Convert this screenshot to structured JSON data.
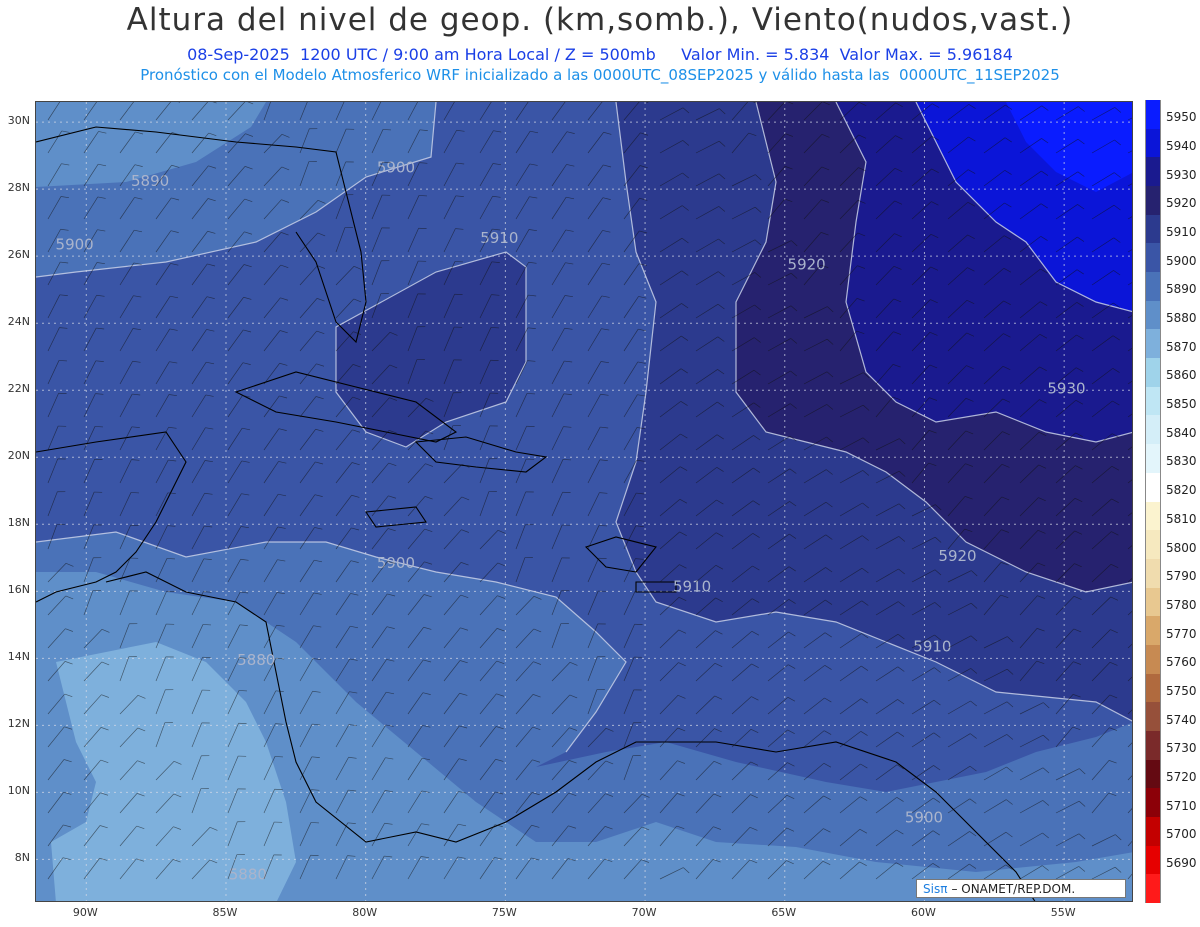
{
  "header": {
    "title": "Altura del nivel de geop. (km,somb.), Viento(nudos,vast.)",
    "line1": "08-Sep-2025  1200 UTC / 9:00 am Hora Local / Z = 500mb     Valor Min. = 5.834  Valor Max. = 5.96184",
    "line2": "Pronóstico con el Modelo Atmosferico WRF inicializado a las 0000UTC_08SEP2025 y válido hasta las  0000UTC_11SEP2025"
  },
  "axes": {
    "lat": [
      "30N",
      "28N",
      "26N",
      "24N",
      "22N",
      "20N",
      "18N",
      "16N",
      "14N",
      "12N",
      "10N",
      "8N"
    ],
    "lon": [
      "90W",
      "85W",
      "80W",
      "75W",
      "70W",
      "65W",
      "60W",
      "55W"
    ]
  },
  "contour_labels": [
    {
      "text": "5890",
      "lon": -88.4,
      "lat": 28.1
    },
    {
      "text": "5900",
      "lon": -79.6,
      "lat": 28.5
    },
    {
      "text": "5900",
      "lon": -91.1,
      "lat": 26.2
    },
    {
      "text": "5910",
      "lon": -75.9,
      "lat": 26.4
    },
    {
      "text": "5920",
      "lon": -64.9,
      "lat": 25.6
    },
    {
      "text": "5930",
      "lon": -55.6,
      "lat": 21.9
    },
    {
      "text": "5920",
      "lon": -59.5,
      "lat": 16.9
    },
    {
      "text": "5900",
      "lon": -79.6,
      "lat": 16.7
    },
    {
      "text": "5910",
      "lon": -69.0,
      "lat": 16.0
    },
    {
      "text": "5910",
      "lon": -60.4,
      "lat": 14.2
    },
    {
      "text": "5880",
      "lon": -84.6,
      "lat": 13.8
    },
    {
      "text": "5900",
      "lon": -60.7,
      "lat": 9.1
    },
    {
      "text": "5880",
      "lon": -84.9,
      "lat": 7.4
    }
  ],
  "legend": {
    "levels": [
      "5950",
      "5940",
      "5930",
      "5920",
      "5910",
      "5900",
      "5890",
      "5880",
      "5870",
      "5860",
      "5850",
      "5840",
      "5830",
      "5820",
      "5810",
      "5800",
      "5790",
      "5780",
      "5770",
      "5760",
      "5750",
      "5740",
      "5730",
      "5720",
      "5710",
      "5700",
      "5690"
    ],
    "colors": [
      "#0a1cff",
      "#0b15d8",
      "#1a1a8f",
      "#26226f",
      "#2c3a8e",
      "#3a55a6",
      "#4a72b8",
      "#5f8fc9",
      "#7eb0dc",
      "#9fd3ea",
      "#bfe6f4",
      "#d4eef8",
      "#e3f5fb",
      "#ffffff",
      "#fbf3cf",
      "#f6e9bf",
      "#f0dcae",
      "#e8c890",
      "#d9a86a",
      "#c78a52",
      "#b06a3e",
      "#96503a",
      "#7a2a2a",
      "#640a12",
      "#8c0008",
      "#c30000",
      "#e60000",
      "#ff1a1a"
    ]
  },
  "credit": {
    "brand": "Sisπ",
    "text": "– ONAMET/REP.DOM."
  }
}
